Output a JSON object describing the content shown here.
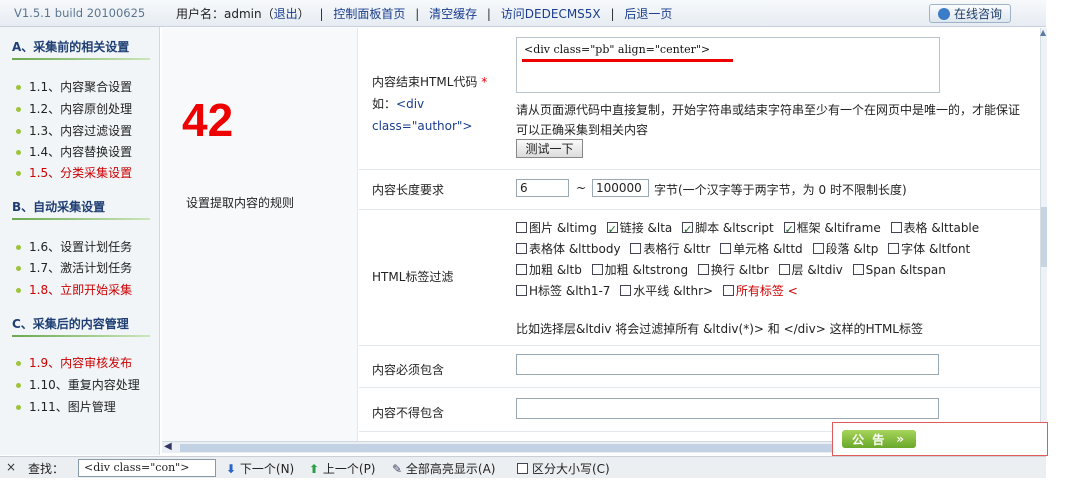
{
  "topbar": {
    "version": "V1.5.1 build 20100625",
    "user_label": "用户名：admin",
    "logout_open": "（",
    "logout": "退出",
    "logout_close": "）",
    "nav": [
      "控制面板首页",
      "清空缓存",
      "访问DEDECMS5X",
      "后退一页"
    ],
    "online_button": "在线咨询"
  },
  "sidebar": {
    "sections": [
      {
        "title": "A、采集前的相关设置",
        "items": [
          {
            "label": "1.1、内容聚合设置",
            "red": false
          },
          {
            "label": "1.2、内容原创处理",
            "red": false
          },
          {
            "label": "1.3、内容过滤设置",
            "red": false
          },
          {
            "label": "1.4、内容替换设置",
            "red": false
          },
          {
            "label": "1.5、分类采集设置",
            "red": true
          }
        ]
      },
      {
        "title": "B、自动采集设置",
        "items": [
          {
            "label": "1.6、设置计划任务",
            "red": false
          },
          {
            "label": "1.7、激活计划任务",
            "red": false
          },
          {
            "label": "1.8、立即开始采集",
            "red": true
          }
        ]
      },
      {
        "title": "C、采集后的内容管理",
        "items": [
          {
            "label": "1.9、内容审核发布",
            "red": true
          },
          {
            "label": "1.10、重复内容处理",
            "red": false
          },
          {
            "label": "1.11、图片管理",
            "red": false
          }
        ]
      }
    ]
  },
  "main": {
    "big_number": "42",
    "rule_label": "设置提取内容的规则",
    "end_code": {
      "label": "内容结束HTML代码",
      "required_mark": "*",
      "example_prefix": "如：",
      "example_code_1": "<div",
      "example_code_2": "class=\"author\">",
      "value": "<div class=\"pb\" align=\"center\">",
      "hint": "请从页面源代码中直接复制，开始字符串或结束字符串至少有一个在网页中是唯一的，才能保证可以正确采集到相关内容",
      "test_button": "测试一下"
    },
    "length": {
      "label": "内容长度要求",
      "min": "6",
      "tilde": "~",
      "max": "100000",
      "note": "字节(一个汉字等于两字节，为 0 时不限制长度)"
    },
    "html_filter": {
      "label": "HTML标签过滤",
      "tags": [
        {
          "label": "图片 &ltimg",
          "checked": false,
          "red": false
        },
        {
          "label": "链接 &lta",
          "checked": true,
          "red": false
        },
        {
          "label": "脚本 &ltscript",
          "checked": true,
          "red": false
        },
        {
          "label": "框架 &ltiframe",
          "checked": true,
          "red": false
        },
        {
          "label": "表格 &lttable",
          "checked": false,
          "red": false
        },
        {
          "label": "表格体 &lttbody",
          "checked": false,
          "red": false
        },
        {
          "label": "表格行 &lttr",
          "checked": false,
          "red": false
        },
        {
          "label": "单元格 &lttd",
          "checked": false,
          "red": false
        },
        {
          "label": "段落 &ltp",
          "checked": false,
          "red": false
        },
        {
          "label": "字体 &ltfont",
          "checked": false,
          "red": false
        },
        {
          "label": "加粗 &ltb",
          "checked": false,
          "red": false
        },
        {
          "label": "加粗 &ltstrong",
          "checked": false,
          "red": false
        },
        {
          "label": "换行 &ltbr",
          "checked": false,
          "red": false
        },
        {
          "label": "层 &ltdiv",
          "checked": false,
          "red": false
        },
        {
          "label": "Span &ltspan",
          "checked": false,
          "red": false
        },
        {
          "label": "H标签 &lth1-7",
          "checked": false,
          "red": false
        },
        {
          "label": "水平线 &lthr>",
          "checked": false,
          "red": false
        },
        {
          "label": "所有标签 <",
          "checked": false,
          "red": true
        }
      ],
      "example": "比如选择层&ltdiv 将会过滤掉所有 &ltdiv(*)> 和 </div> 这样的HTML标签"
    },
    "must_contain": {
      "label": "内容必须包含",
      "value": ""
    },
    "must_not_contain": {
      "label": "内容不得包含",
      "value": ""
    }
  },
  "notice": {
    "label": "公 告",
    "arrow": "»"
  },
  "findbar": {
    "close": "×",
    "label": "查找：",
    "value": "<div class=\"con\">",
    "next": "下一个(N)",
    "prev": "上一个(P)",
    "highlight": "全部高亮显示(A)",
    "match_case": "区分大小写(C)"
  }
}
